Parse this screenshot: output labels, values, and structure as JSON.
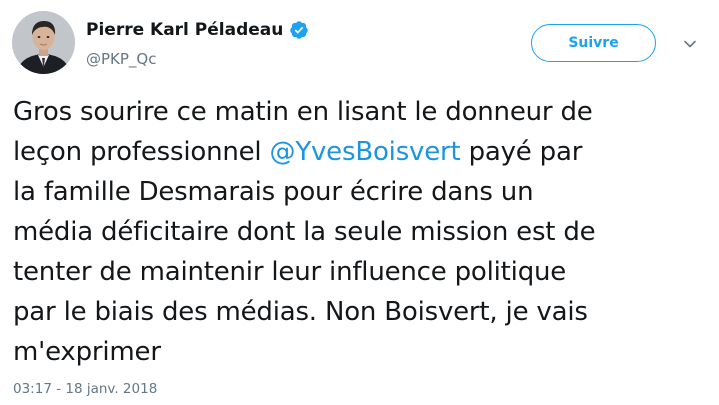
{
  "author": {
    "display_name": "Pierre Karl Péladeau",
    "handle": "@PKP_Qc",
    "verified": true,
    "avatar_icon": "profile-photo"
  },
  "actions": {
    "follow_label": "Suivre",
    "menu_icon": "chevron-down-icon"
  },
  "tweet": {
    "lines": [
      {
        "text": "Gros sourire ce matin en lisant le donneur de"
      },
      {
        "before": "leçon professionnel ",
        "mention": "@YvesBoisvert",
        "after": " payé par"
      },
      {
        "text": "la famille Desmarais pour écrire dans un"
      },
      {
        "text": "média déficitaire dont la seule mission est de"
      },
      {
        "text": "tenter de maintenir leur influence politique"
      },
      {
        "text": "par le biais des médias. Non Boisvert, je vais"
      },
      {
        "text": "m'exprimer"
      }
    ],
    "timestamp": "03:17 - 18 janv. 2018"
  },
  "colors": {
    "accent": "#1da1f2",
    "mention": "#1b95e0",
    "muted": "#657786",
    "text": "#14171a"
  }
}
